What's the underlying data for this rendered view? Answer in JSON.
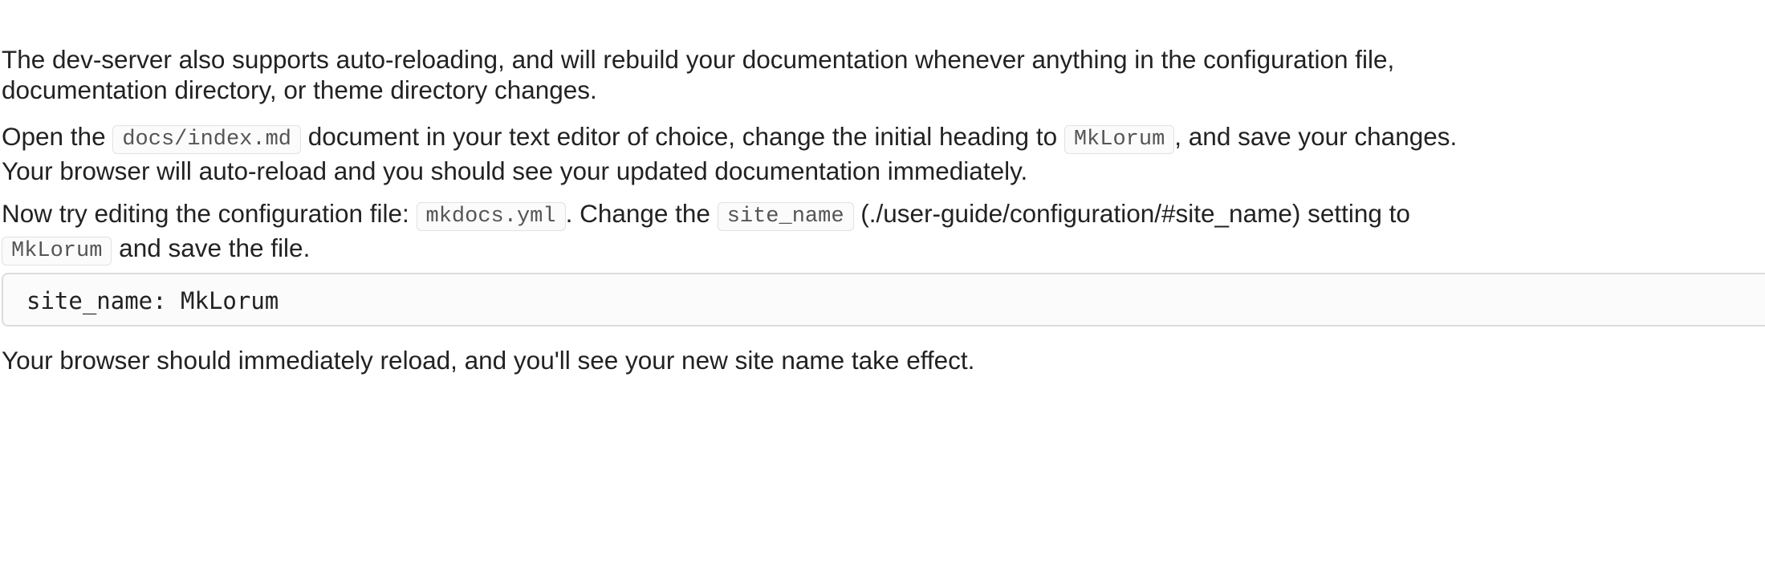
{
  "paragraph1": {
    "text": "The dev-server also supports auto-reloading, and will rebuild your documentation whenever anything in the configuration file, documentation directory, or theme directory changes.",
    "line1": "The dev-server also supports auto-reloading, and will rebuild your documentation whenever anything in the configuration file,",
    "line2": "documentation directory, or theme directory changes."
  },
  "paragraph2": {
    "t1": "Open the ",
    "code1": "docs/index.md",
    "t2": " document in your text editor of choice, change the initial heading to ",
    "code2": "MkLorum",
    "t3": ", and save your changes.",
    "line2": "Your browser will auto-reload and you should see your updated documentation immediately."
  },
  "paragraph3": {
    "t1": "Now try editing the configuration file: ",
    "code1": "mkdocs.yml",
    "t2": ". Change the ",
    "code2": "site_name",
    "t3": " (./user-guide/configuration/#site_name) setting to",
    "code3": "MkLorum",
    "t4": " and save the file."
  },
  "code_block": {
    "content": "site_name: MkLorum"
  },
  "paragraph4": {
    "text": "Your browser should immediately reload, and you'll see your new site name take effect."
  }
}
